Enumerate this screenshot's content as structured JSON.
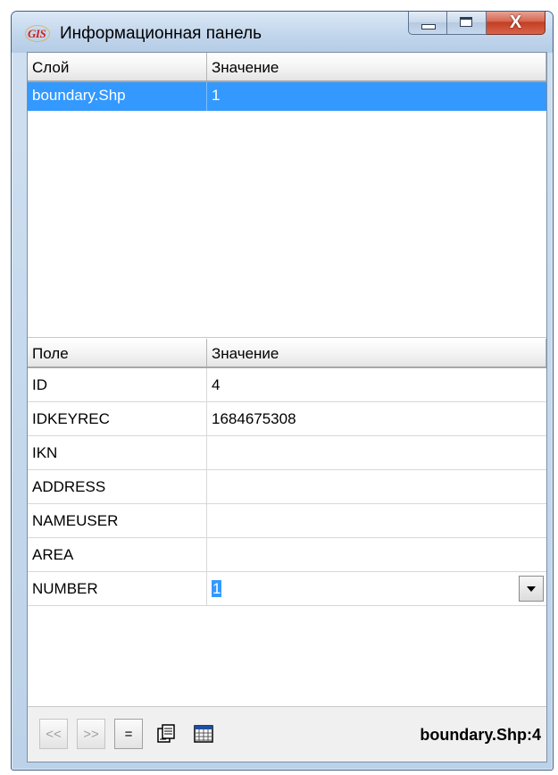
{
  "window": {
    "icon_label": "GIS",
    "title": "Информационная панель",
    "close_glyph": "X"
  },
  "layers": {
    "headers": [
      "Слой",
      "Значение"
    ],
    "rows": [
      {
        "name": "boundary.Shp",
        "value": "1",
        "selected": true
      }
    ]
  },
  "fields": {
    "headers": [
      "Поле",
      "Значение"
    ],
    "rows": [
      {
        "name": "ID",
        "value": "4"
      },
      {
        "name": "IDKEYREC",
        "value": "1684675308"
      },
      {
        "name": "IKN",
        "value": ""
      },
      {
        "name": "ADDRESS",
        "value": ""
      },
      {
        "name": "NAMEUSER",
        "value": ""
      },
      {
        "name": "AREA",
        "value": ""
      },
      {
        "name": "NUMBER",
        "value": "1",
        "editing": true
      }
    ]
  },
  "toolbar": {
    "prev_label": "<<",
    "next_label": ">>",
    "equals_label": "=",
    "status": "boundary.Shp:4"
  },
  "icons": {
    "app": "gis-logo-icon",
    "minimize": "minimize-icon",
    "maximize": "maximize-icon",
    "close": "close-icon",
    "dropdown": "chevron-down-icon",
    "document": "document-edit-icon",
    "table": "table-icon"
  },
  "colors": {
    "selection": "#3399ff",
    "close_button": "#c33f24",
    "title_bar": "#c2d6ec"
  }
}
